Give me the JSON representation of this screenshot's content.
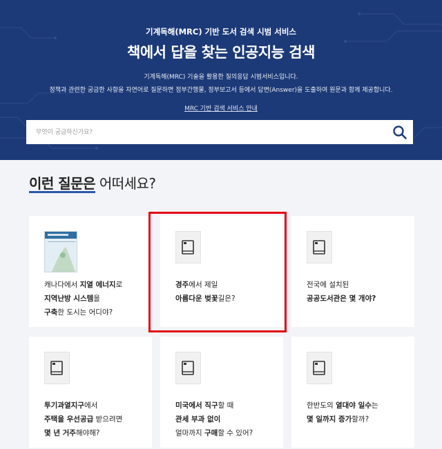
{
  "hero": {
    "subtitle": "기계독해(MRC) 기반 도서 검색 시범 서비스",
    "title": "책에서 답을 찾는 인공지능 검색",
    "desc1": "기계독해(MRC) 기술을 활용한 질의응답 시범서비스입니다.",
    "desc2": "정책과 관련한 궁금한 사항을 자연어로 질문하면 정부간행물, 정부보고서 등에서 답변(Answer)을 도출하여 원문과 함께 제공합니다.",
    "link": "MRC 기반 검색 서비스 안내"
  },
  "search": {
    "placeholder": "무엇이 궁금하신가요?",
    "icon": "search-icon"
  },
  "section": {
    "title_strong": "이런 질문은",
    "title_rest": " 어떠세요?"
  },
  "cards": [
    {
      "icon": "report-cover",
      "lines": [
        [
          [
            "캐나다에서 ",
            false
          ],
          [
            "지열 에너지",
            true
          ],
          [
            "로",
            false
          ]
        ],
        [
          [
            "지역난방 시스템",
            true
          ],
          [
            "을",
            false
          ]
        ],
        [
          [
            "구축",
            true
          ],
          [
            "한 도시는 어디야?",
            false
          ]
        ]
      ]
    },
    {
      "icon": "book-icon",
      "lines": [
        [
          [
            "경주",
            true
          ],
          [
            "에서 제일",
            false
          ]
        ],
        [
          [
            "아름다운 벚꽃",
            true
          ],
          [
            "길은?",
            false
          ]
        ]
      ]
    },
    {
      "icon": "book-icon",
      "lines": [
        [
          [
            "전국에 설치된",
            false
          ]
        ],
        [
          [
            "공공도서관은 몇 개야?",
            true
          ]
        ]
      ]
    },
    {
      "icon": "book-icon",
      "lines": [
        [
          [
            "투기과열지구",
            true
          ],
          [
            "에서",
            false
          ]
        ],
        [
          [
            "주택을 우선공급",
            true
          ],
          [
            " 받으려면",
            false
          ]
        ],
        [
          [
            "몇 년 거주",
            true
          ],
          [
            "해야해?",
            false
          ]
        ]
      ]
    },
    {
      "icon": "book-icon",
      "lines": [
        [
          [
            "미국에서 직구",
            true
          ],
          [
            "할 때",
            false
          ]
        ],
        [
          [
            "관세 부과 없이",
            true
          ]
        ],
        [
          [
            "얼마까지 ",
            false
          ],
          [
            "구매",
            true
          ],
          [
            "할 수 있어?",
            false
          ]
        ]
      ]
    },
    {
      "icon": "book-icon",
      "lines": [
        [
          [
            "한반도의 ",
            false
          ],
          [
            "열대야 일수",
            true
          ],
          [
            "는",
            false
          ]
        ],
        [
          [
            "몇 일까지 증가",
            true
          ],
          [
            "할까?",
            false
          ]
        ]
      ]
    }
  ],
  "colors": {
    "hero_bg": "#1d3a78",
    "accent_underline": "#2d57a8",
    "highlight_border": "#e30613"
  }
}
